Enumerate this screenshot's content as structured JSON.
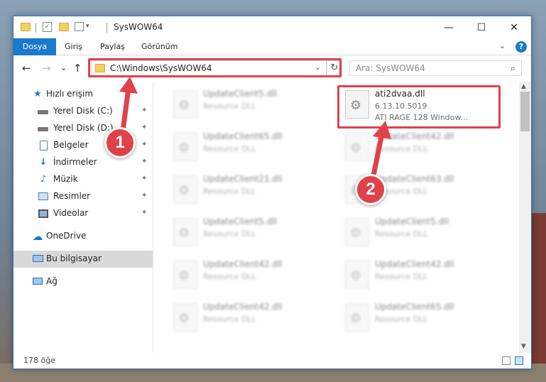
{
  "window": {
    "title": "SysWOW64"
  },
  "titlebar": {
    "minimize": "—",
    "maximize": "☐",
    "close": "✕"
  },
  "ribbon": {
    "tabs": [
      "Dosya",
      "Giriş",
      "Paylaş",
      "Görünüm"
    ],
    "help": "?"
  },
  "nav": {
    "back": "←",
    "forward": "→",
    "recent": "⌄",
    "up": "↑",
    "address": "C:\\Windows\\SysWOW64",
    "refresh": "↻",
    "search_placeholder": "Ara: SysWOW64"
  },
  "sidebar": {
    "items": [
      {
        "label": "Hızlı erişim",
        "icon": "star-icon",
        "pinned": false
      },
      {
        "label": "Yerel Disk (C:)",
        "icon": "drive-icon",
        "pinned": true
      },
      {
        "label": "Yerel Disk (D:)",
        "icon": "drive-icon",
        "pinned": true
      },
      {
        "label": "Belgeler",
        "icon": "documents-icon",
        "pinned": true
      },
      {
        "label": "İndirmeler",
        "icon": "download-icon",
        "pinned": true
      },
      {
        "label": "Müzik",
        "icon": "music-icon",
        "pinned": true
      },
      {
        "label": "Resimler",
        "icon": "pictures-icon",
        "pinned": true
      },
      {
        "label": "Videolar",
        "icon": "videos-icon",
        "pinned": true
      },
      {
        "label": "OneDrive",
        "icon": "cloud-icon",
        "pinned": false
      },
      {
        "label": "Bu bilgisayar",
        "icon": "computer-icon",
        "pinned": false,
        "selected": true
      },
      {
        "label": "Ağ",
        "icon": "network-icon",
        "pinned": false
      }
    ],
    "pin_glyph": "📌"
  },
  "files": {
    "highlighted": {
      "name": "ati2dvaa.dll",
      "version": "6.13.10.5019",
      "description": "ATI RAGE 128 Window..."
    },
    "left_column": [
      {
        "name": "UpdateClient5.dll",
        "type": "Resource DLL"
      },
      {
        "name": "UpdateClient65.dll",
        "type": "Resource DLL"
      },
      {
        "name": "UpdateClient21.dll",
        "type": "Resource DLL"
      },
      {
        "name": "UpdateClient5.dll",
        "type": "Resource DLL"
      },
      {
        "name": "UpdateClient42.dll",
        "type": "Resource DLL"
      },
      {
        "name": "UpdateClient42.dll",
        "type": "Resource DLL"
      }
    ],
    "right_column": [
      {
        "name": "UpdateClient42.dll",
        "type": "Resource DLL"
      },
      {
        "name": "UpdateClient63.dll",
        "type": "Resource DLL"
      },
      {
        "name": "UpdateClient5.dll",
        "type": "Resource DLL"
      },
      {
        "name": "UpdateClient42.dll",
        "type": "Resource DLL"
      },
      {
        "name": "UpdateClient65.dll",
        "type": "Resource DLL"
      }
    ]
  },
  "status": {
    "count": "178 öğe"
  },
  "annotations": {
    "marker1": "1",
    "marker2": "2",
    "highlight_color": "#e0424a"
  },
  "colors": {
    "accent": "#1979ca",
    "selection": "#d9d9d9"
  }
}
